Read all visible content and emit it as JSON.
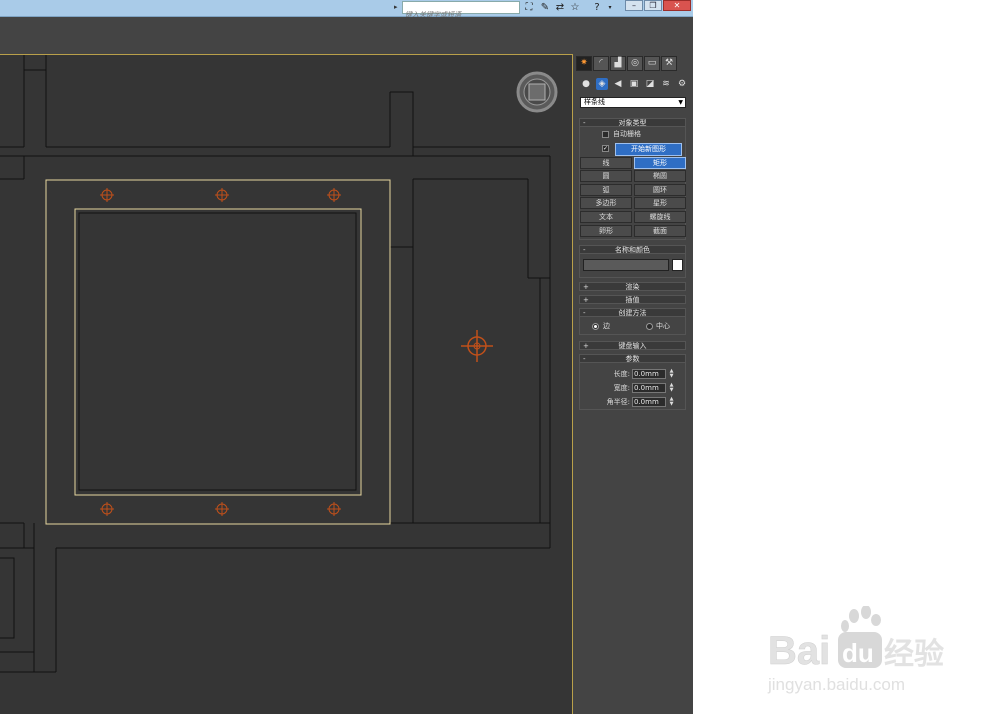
{
  "search": {
    "placeholder": "键入关键字或短语"
  },
  "create_panel": {
    "dropdown_value": "样条线",
    "object_type": {
      "title": "对象类型",
      "auto_grid_label": "自动栅格",
      "start_new_shape_label": "开始新图形",
      "start_new_shape_checked": true,
      "buttons": [
        "线",
        "矩形",
        "圆",
        "椭圆",
        "弧",
        "圆环",
        "多边形",
        "星形",
        "文本",
        "螺旋线",
        "卵形",
        "截面"
      ],
      "active_button": "矩形"
    },
    "name_color": {
      "title": "名称和颜色",
      "name_value": "",
      "swatch_color": "#ffffff"
    },
    "rollouts": {
      "render": "渲染",
      "interpolation": "插值",
      "keyboard": "键盘输入"
    },
    "creation_method": {
      "title": "创建方法",
      "option_edge": "边",
      "option_center": "中心",
      "selected": "边"
    },
    "parameters": {
      "title": "参数",
      "length_label": "长度:",
      "length_value": "0.0mm",
      "width_label": "宽度:",
      "width_value": "0.0mm",
      "corner_label": "角半径:",
      "corner_value": "0.0mm"
    }
  },
  "colors": {
    "viewport_bg": "#353535",
    "ui_bg": "#444444",
    "accent": "#2f6ec4",
    "selection": "#e8d7a0",
    "gizmo": "#c0501a",
    "title_bar": "#a9cbe8"
  },
  "icons": [
    "search-arrow-icon",
    "binoculars-icon",
    "tools-icon",
    "exchange-icon",
    "star-icon",
    "help-icon",
    "minimize-icon",
    "restore-icon",
    "close-icon",
    "viewcube-icon"
  ],
  "watermark": {
    "brand": "Bai du 经验",
    "url": "jingyan.baidu.com"
  }
}
